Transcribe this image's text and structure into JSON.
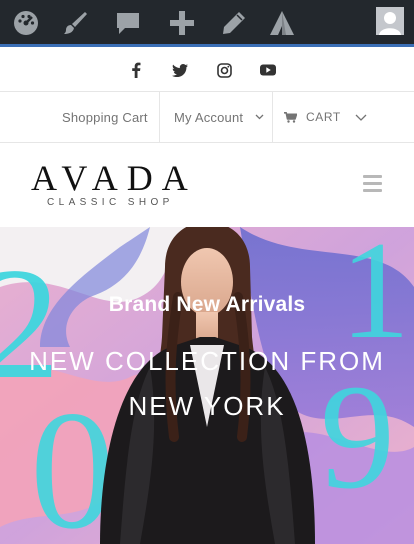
{
  "admin_bar": {
    "icons": [
      "dashboard-icon",
      "customize-brush-icon",
      "comments-icon",
      "new-content-icon",
      "edit-pencil-icon",
      "avada-logo-icon"
    ],
    "avatar": "user-avatar-icon",
    "accent_color": "#3b6fb6",
    "background": "#23282d"
  },
  "social": {
    "icons": [
      "facebook-icon",
      "twitter-icon",
      "instagram-icon",
      "youtube-icon"
    ]
  },
  "secondary_menu": {
    "shopping_cart": "Shopping Cart",
    "my_account": "My Account",
    "cart": "CART"
  },
  "logo": {
    "main": "AVADA",
    "sub": "CLASSIC SHOP"
  },
  "hero": {
    "subtitle": "Brand New Arrivals",
    "title_line1": "NEW COLLECTION FROM",
    "title_line2": "NEW YORK"
  }
}
